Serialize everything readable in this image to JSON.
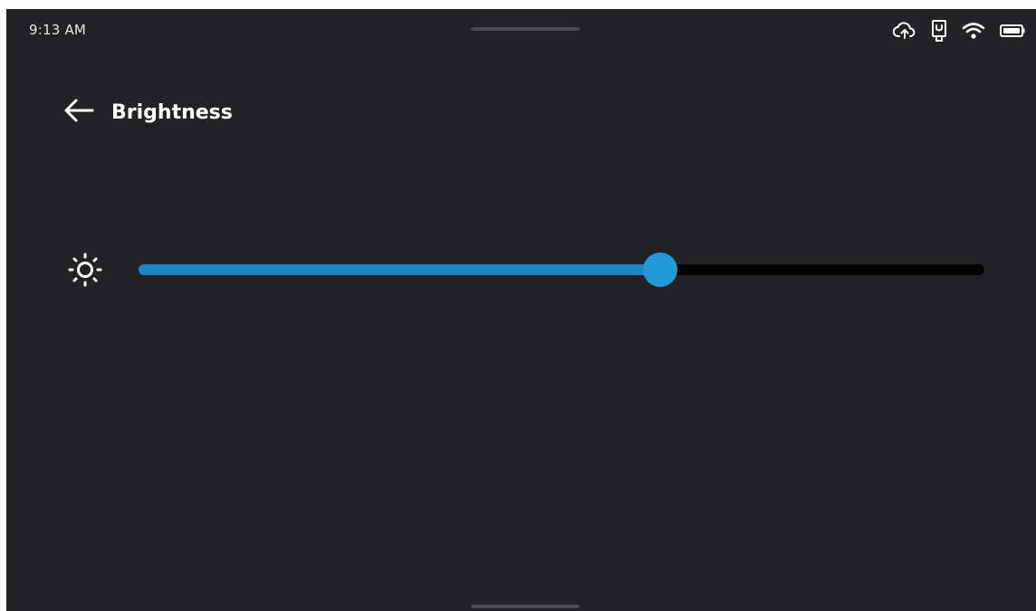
{
  "status_bar": {
    "time": "9:13 AM",
    "icons": [
      "cloud-upload-icon",
      "usb-device-icon",
      "wifi-icon",
      "battery-icon"
    ]
  },
  "header": {
    "back_icon": "arrow-left-icon",
    "title": "Brightness"
  },
  "brightness": {
    "icon": "sun-icon",
    "level": 0.617
  },
  "colors": {
    "background": "#232326",
    "accent": "#1e86c4",
    "thumb": "#2399d9",
    "track": "#050505"
  }
}
